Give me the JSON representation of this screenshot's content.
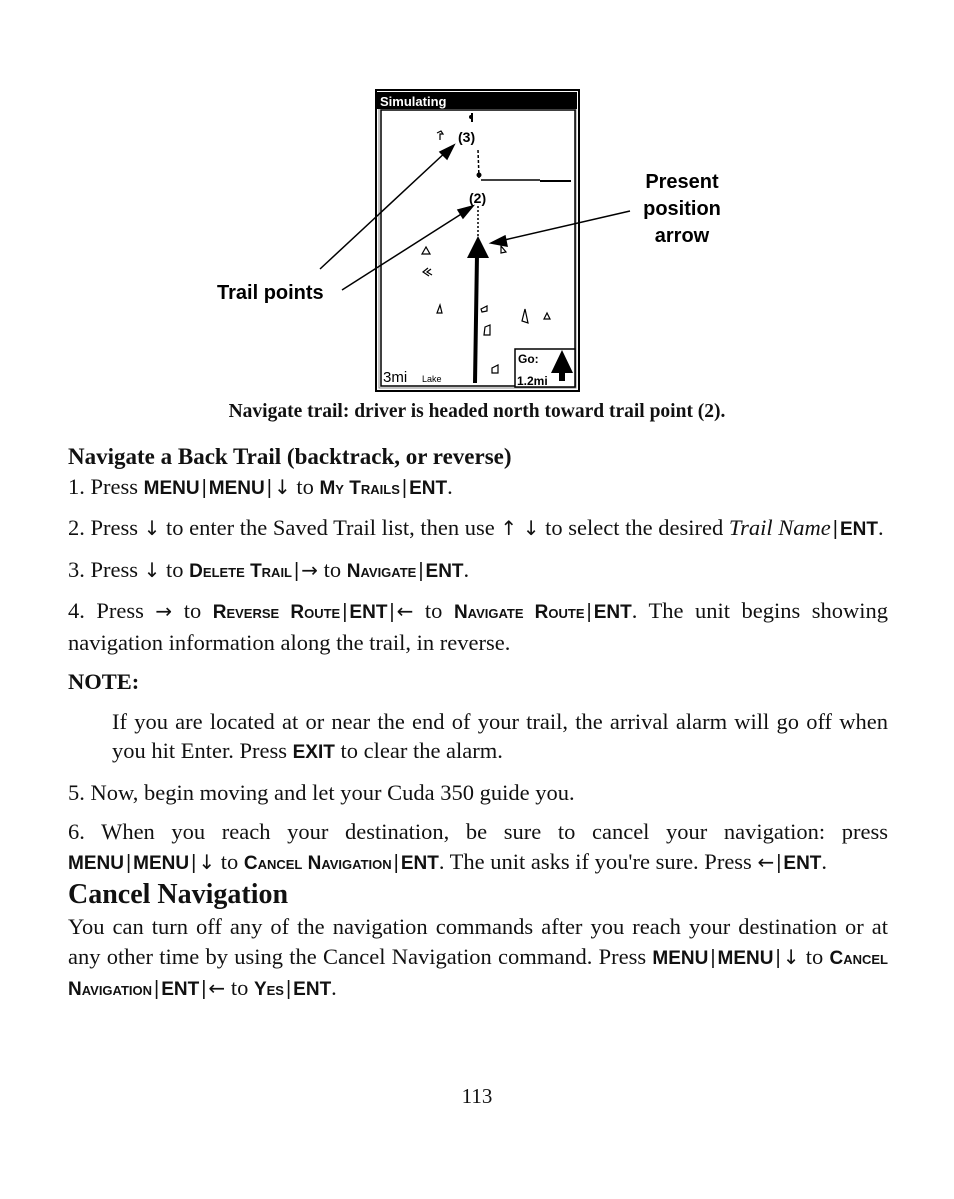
{
  "figure": {
    "screen_title": "Simulating",
    "trail_point_labels": [
      "(3)",
      "(2)"
    ],
    "scale_label": "3mi",
    "map_label": "Lake",
    "go_label": "Go:",
    "go_distance": "1.2mi",
    "callout_trail_points": "Trail points",
    "callout_present_position": [
      "Present",
      "position",
      "arrow"
    ],
    "caption": "Navigate trail: driver is headed north toward trail point (2)."
  },
  "section_back_trail": {
    "heading": "Navigate a Back Trail (backtrack, or reverse)",
    "step1": {
      "prefix": "1. Press ",
      "k1": "MENU",
      "k2": "MENU",
      "arrow": "↓",
      "to": " to ",
      "item": "My Trails",
      "k3": "ENT",
      "end": "."
    },
    "step2": {
      "prefix": "2. Press ",
      "arrow1": "↓",
      "mid": " to enter the Saved Trail list, then use ",
      "arrow2": "↑",
      "arrow3": "↓",
      "mid2": " to select the desired ",
      "italic": "Trail Name",
      "k1": "ENT",
      "end": "."
    },
    "step3": {
      "prefix": "3. Press ",
      "arrow1": "↓",
      "to1": " to ",
      "item1": "Delete Trail",
      "arrow2": "→",
      "to2": " to ",
      "item2": "Navigate",
      "k1": "ENT",
      "end": "."
    },
    "step4": {
      "prefix": "4. Press ",
      "arrow1": "→",
      "to1": " to ",
      "item1": "Reverse Route",
      "k1": "ENT",
      "arrow2": "←",
      "to2": " to ",
      "item2": "Navigate Route",
      "k2": "ENT",
      "end": ". The unit begins showing navigation information along the trail, in reverse."
    },
    "note_label": "NOTE:",
    "note": {
      "text1": "If you are located at or near the end of your trail, the arrival alarm will go off when you hit Enter. Press ",
      "key": "EXIT",
      "text2": " to clear the alarm."
    },
    "step5": "5. Now, begin moving and let your Cuda 350 guide you.",
    "step6": {
      "prefix": "6. When you reach your destination, be sure to cancel your navigation: press ",
      "k1": "MENU",
      "k2": "MENU",
      "arrow1": "↓",
      "to1": " to ",
      "item1": "Cancel Navigation",
      "k3": "ENT",
      "mid": ". The unit asks if you're sure. Press ",
      "arrow2": "←",
      "k4": "ENT",
      "end": "."
    }
  },
  "section_cancel": {
    "heading": "Cancel Navigation",
    "text1": "You can turn off any of the navigation commands after you reach your destination or at any other time by using the Cancel Navigation command. Press ",
    "k1": "MENU",
    "k2": "MENU",
    "arrow1": "↓",
    "to1": " to ",
    "item1": "Cancel Navigation",
    "k3": "ENT",
    "arrow2": "←",
    "to2": " to ",
    "item2": "Yes",
    "k4": "ENT",
    "end": "."
  },
  "page_number": "113"
}
